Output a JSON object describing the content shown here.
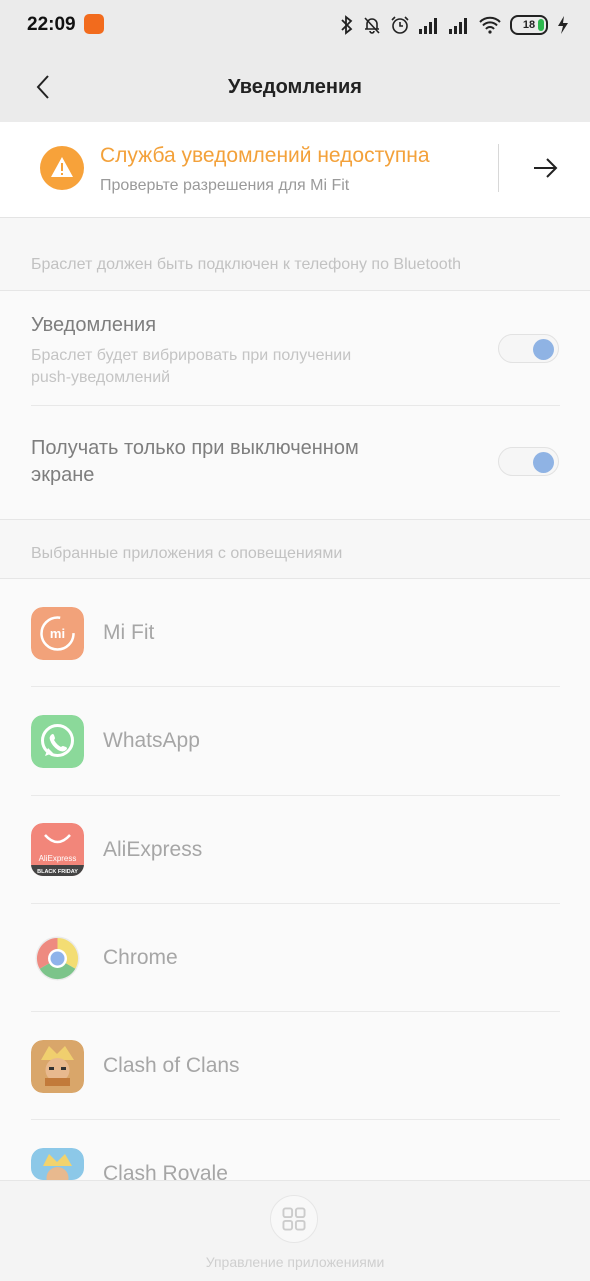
{
  "status": {
    "time": "22:09",
    "battery": "18"
  },
  "header": {
    "title": "Уведомления"
  },
  "banner": {
    "title": "Служба уведомлений недоступна",
    "subtitle": "Проверьте разрешения для Mi Fit",
    "accent": "#f3a13a"
  },
  "section1": {
    "label": "Браслет должен быть подключен к телефону по Bluetooth"
  },
  "settings": [
    {
      "title": "Уведомления",
      "subtitle_line1": "Браслет будет вибрировать при получении",
      "subtitle_line2": "push-уведомлений",
      "enabled": true
    },
    {
      "title_line1": "Получать только при выключенном",
      "title_line2": "экране",
      "enabled": true
    }
  ],
  "section2": {
    "label": "Выбранные приложения с оповещениями"
  },
  "apps": [
    {
      "name": "Mi Fit",
      "icon": "mifit-icon"
    },
    {
      "name": "WhatsApp",
      "icon": "whatsapp-icon"
    },
    {
      "name": "AliExpress",
      "icon": "aliexpress-icon",
      "icon_text": "AliExpress",
      "icon_badge": "BLACK FRIDAY"
    },
    {
      "name": "Chrome",
      "icon": "chrome-icon"
    },
    {
      "name": "Clash of Clans",
      "icon": "clash-of-clans-icon"
    },
    {
      "name": "Clash Royale",
      "icon": "clash-royale-icon"
    }
  ],
  "bottom": {
    "label": "Управление приложениями"
  }
}
